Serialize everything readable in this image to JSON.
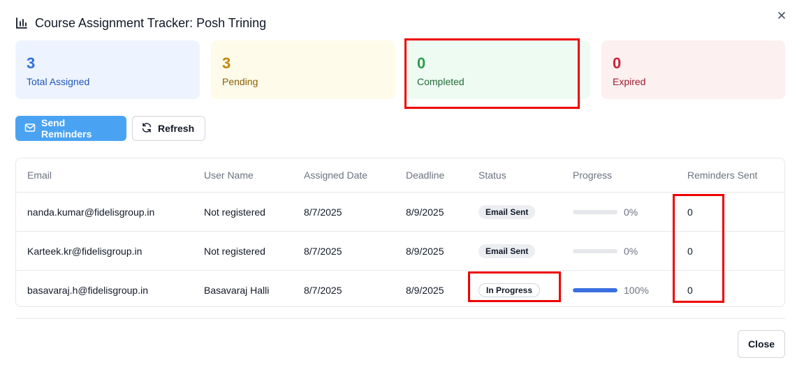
{
  "dialog": {
    "title": "Course Assignment Tracker: Posh Trining",
    "close_button": "Close"
  },
  "stats": {
    "total": {
      "value": "3",
      "label": "Total Assigned"
    },
    "pending": {
      "value": "3",
      "label": "Pending"
    },
    "completed": {
      "value": "0",
      "label": "Completed"
    },
    "expired": {
      "value": "0",
      "label": "Expired"
    }
  },
  "actions": {
    "send_reminders": "Send Reminders",
    "refresh": "Refresh"
  },
  "table": {
    "headers": [
      "Email",
      "User Name",
      "Assigned Date",
      "Deadline",
      "Status",
      "Progress",
      "Reminders Sent"
    ],
    "rows": [
      {
        "email": "nanda.kumar@fidelisgroup.in",
        "user_name": "Not registered",
        "assigned_date": "8/7/2025",
        "deadline": "8/9/2025",
        "status": "Email Sent",
        "progress": 0,
        "progress_label": "0%",
        "reminders_sent": "0"
      },
      {
        "email": "Karteek.kr@fidelisgroup.in",
        "user_name": "Not registered",
        "assigned_date": "8/7/2025",
        "deadline": "8/9/2025",
        "status": "Email Sent",
        "progress": 0,
        "progress_label": "0%",
        "reminders_sent": "0"
      },
      {
        "email": "basavaraj.h@fidelisgroup.in",
        "user_name": "Basavaraj Halli",
        "assigned_date": "8/7/2025",
        "deadline": "8/9/2025",
        "status": "In Progress",
        "progress": 100,
        "progress_label": "100%",
        "reminders_sent": "0"
      }
    ]
  },
  "colors": {
    "primary_button": "#4aa3f2",
    "progress_fill": "#3b6fe0",
    "highlight": "#ee0000"
  }
}
